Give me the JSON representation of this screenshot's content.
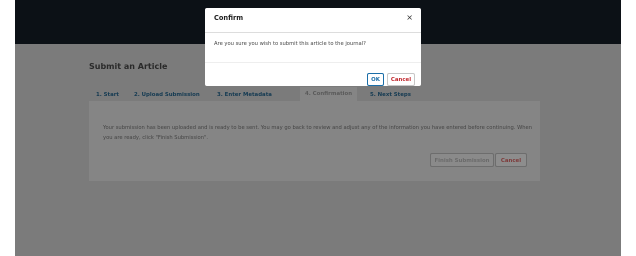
{
  "page": {
    "title": "Submit an Article"
  },
  "tabs": [
    {
      "label": "1. Start"
    },
    {
      "label": "2. Upload Submission"
    },
    {
      "label": "3. Enter Metadata"
    },
    {
      "label": "4. Confirmation"
    },
    {
      "label": "5. Next Steps"
    }
  ],
  "confirmation": {
    "text": "Your submission has been uploaded and is ready to be sent. You may go back to review and adjust any of the information you have entered before continuing. When you are ready, click \"Finish Submission\".",
    "finish_label": "Finish Submission",
    "cancel_label": "Cancel"
  },
  "modal": {
    "title": "Confirm",
    "close_glyph": "×",
    "message": "Are you sure you wish to submit this article to the journal?",
    "ok_label": "OK",
    "cancel_label": "Cancel"
  },
  "colors": {
    "topbar": "#0c1116",
    "overlay_background": "#7b7b7b",
    "primary": "#1b6ea8",
    "danger": "#c0272d"
  }
}
